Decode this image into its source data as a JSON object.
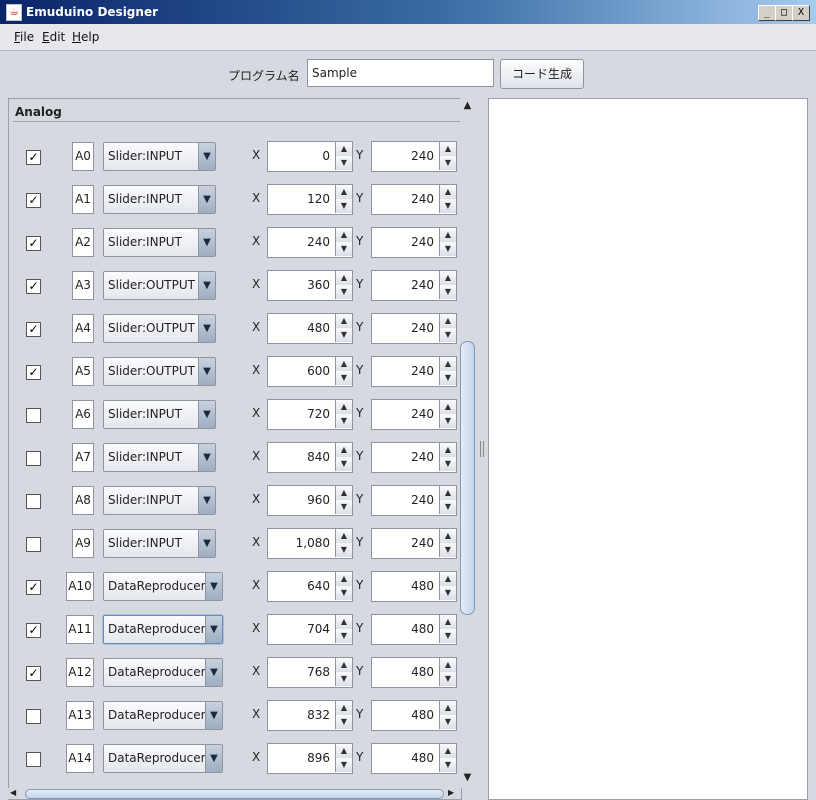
{
  "window": {
    "title": "Emuduino Designer",
    "controls": [
      "_",
      "□",
      "X"
    ]
  },
  "menu": [
    {
      "mnemonic": "F",
      "rest": "ile"
    },
    {
      "mnemonic": "E",
      "rest": "dit"
    },
    {
      "mnemonic": "H",
      "rest": "elp"
    }
  ],
  "program": {
    "label": "プログラム名",
    "value": "Sample",
    "generate_label": "コード生成"
  },
  "analog": {
    "title": "Analog",
    "axis_x": "X",
    "axis_y": "Y",
    "rows": [
      {
        "checked": true,
        "pin": "A0",
        "type": "Slider:INPUT",
        "x": "0",
        "y": "240"
      },
      {
        "checked": true,
        "pin": "A1",
        "type": "Slider:INPUT",
        "x": "120",
        "y": "240"
      },
      {
        "checked": true,
        "pin": "A2",
        "type": "Slider:INPUT",
        "x": "240",
        "y": "240"
      },
      {
        "checked": true,
        "pin": "A3",
        "type": "Slider:OUTPUT",
        "x": "360",
        "y": "240"
      },
      {
        "checked": true,
        "pin": "A4",
        "type": "Slider:OUTPUT",
        "x": "480",
        "y": "240"
      },
      {
        "checked": true,
        "pin": "A5",
        "type": "Slider:OUTPUT",
        "x": "600",
        "y": "240"
      },
      {
        "checked": false,
        "pin": "A6",
        "type": "Slider:INPUT",
        "x": "720",
        "y": "240"
      },
      {
        "checked": false,
        "pin": "A7",
        "type": "Slider:INPUT",
        "x": "840",
        "y": "240"
      },
      {
        "checked": false,
        "pin": "A8",
        "type": "Slider:INPUT",
        "x": "960",
        "y": "240"
      },
      {
        "checked": false,
        "pin": "A9",
        "type": "Slider:INPUT",
        "x": "1,080",
        "y": "240"
      },
      {
        "checked": true,
        "pin": "A10",
        "type": "DataReproducer",
        "x": "640",
        "y": "480"
      },
      {
        "checked": true,
        "pin": "A11",
        "type": "DataReproducer",
        "x": "704",
        "y": "480",
        "focused": true
      },
      {
        "checked": true,
        "pin": "A12",
        "type": "DataReproducer",
        "x": "768",
        "y": "480"
      },
      {
        "checked": false,
        "pin": "A13",
        "type": "DataReproducer",
        "x": "832",
        "y": "480"
      },
      {
        "checked": false,
        "pin": "A14",
        "type": "DataReproducer",
        "x": "896",
        "y": "480"
      }
    ]
  },
  "icons": {
    "checkmark": "✓",
    "combo_arrow": "▼",
    "spin_up": "▲",
    "spin_down": "▼"
  }
}
